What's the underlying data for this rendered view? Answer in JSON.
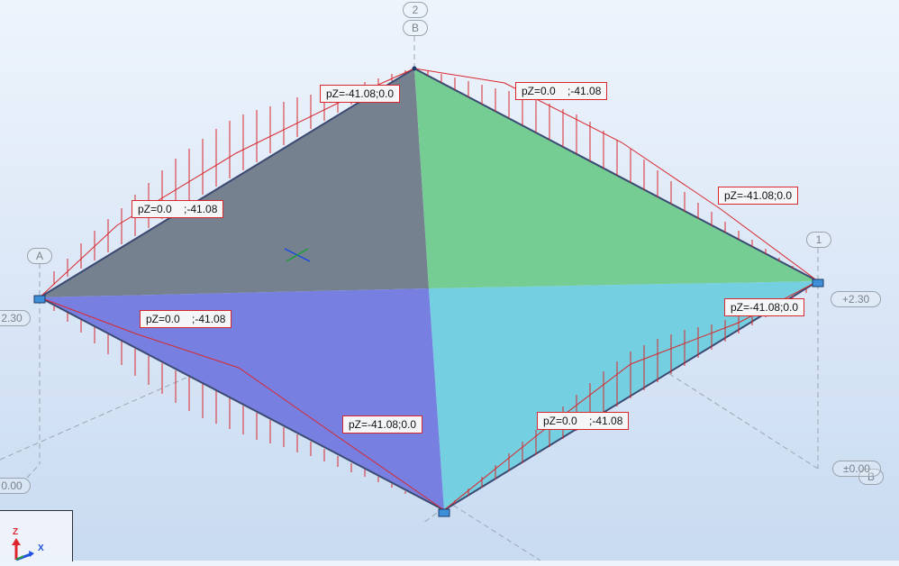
{
  "view": {
    "background_top": "#eef4fc",
    "background_bottom": "#c9dbf1",
    "panel_colors": {
      "back_left": "#75818f",
      "back_right": "#76cd93",
      "front_left": "#7780e0",
      "front_right": "#74cfe0"
    },
    "load_color": "#d8282e"
  },
  "grid_labels": {
    "axis_2": "2",
    "axis_B_top": "B",
    "axis_A": "A",
    "axis_1": "1",
    "axis_B_bottom": "B",
    "level_left": "2.30",
    "level_right": "+2.30",
    "level_bottom_right": "±0.00",
    "level_bottom_left": "0.00"
  },
  "loads": [
    {
      "id": "top-left",
      "text": "pZ=-41.08;0.0"
    },
    {
      "id": "top-right",
      "text": "pZ=0.0    ;-41.08"
    },
    {
      "id": "left-upper",
      "text": "pZ=0.0    ;-41.08"
    },
    {
      "id": "right-upper",
      "text": "pZ=-41.08;0.0"
    },
    {
      "id": "left-lower",
      "text": "pZ=0.0    ;-41.08"
    },
    {
      "id": "right-lower",
      "text": "pZ=-41.08;0.0"
    },
    {
      "id": "bottom-center",
      "text": "pZ=-41.08;0.0"
    },
    {
      "id": "bottom-right",
      "text": "pZ=0.0    ;-41.08"
    }
  ],
  "axes": {
    "z": "Z",
    "x": "X"
  }
}
